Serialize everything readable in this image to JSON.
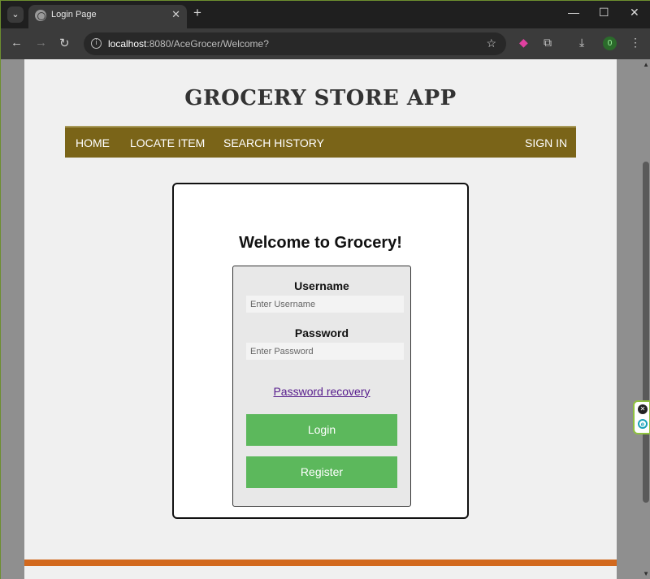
{
  "browser": {
    "tab_title": "Login Page",
    "url_host": "localhost",
    "url_rest": ":8080/AceGrocer/Welcome?",
    "extension_badge": "0"
  },
  "app": {
    "title": "GROCERY STORE APP",
    "nav": {
      "home": "HOME",
      "locate_item": "LOCATE ITEM",
      "search_history": "SEARCH HISTORY",
      "sign_in": "SIGN IN"
    }
  },
  "login": {
    "heading": "Welcome to Grocery!",
    "username_label": "Username",
    "username_placeholder": "Enter Username",
    "password_label": "Password",
    "password_placeholder": "Enter Password",
    "recovery_link": "Password recovery",
    "login_button": "Login",
    "register_button": "Register"
  },
  "colors": {
    "navbar": "#7a6418",
    "button": "#5cb85c",
    "footer_bar": "#d2691e",
    "link": "#551a8b"
  }
}
